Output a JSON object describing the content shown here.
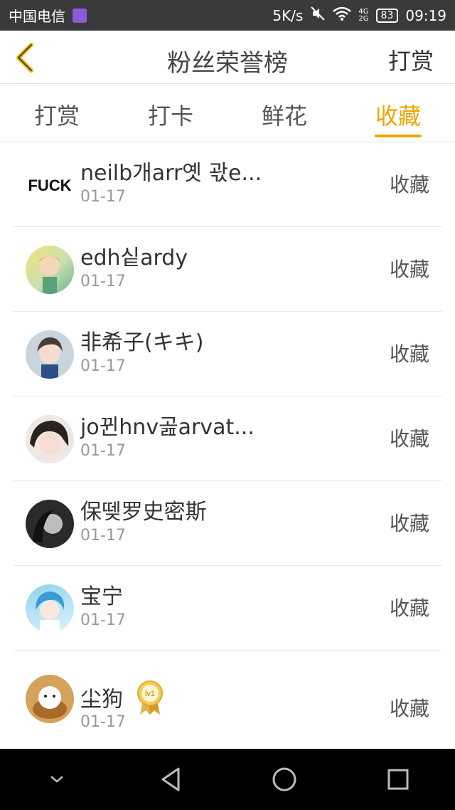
{
  "status_bar": {
    "carrier": "中国电信",
    "speed": "5K/s",
    "battery": "83",
    "time": "09:19",
    "net_4g": "4G",
    "net_2g": "2G"
  },
  "header": {
    "title": "粉丝荣誉榜",
    "right_action": "打赏"
  },
  "tabs": [
    {
      "label": "打赏",
      "active": false
    },
    {
      "label": "打卡",
      "active": false
    },
    {
      "label": "鲜花",
      "active": false
    },
    {
      "label": "收藏",
      "active": true
    }
  ],
  "list": [
    {
      "name": "neilb개arr옛 곿e...",
      "date": "01-17",
      "action": "收藏",
      "avatar_text": "FUCK"
    },
    {
      "name": "edh싵ardy",
      "date": "01-17",
      "action": "收藏"
    },
    {
      "name": "非希子(キキ)",
      "date": "01-17",
      "action": "收藏"
    },
    {
      "name": "jo뀐hnv곮arvat...",
      "date": "01-17",
      "action": "收藏"
    },
    {
      "name": "保뗒罗史密斯",
      "date": "01-17",
      "action": "收藏"
    },
    {
      "name": "宝宁",
      "date": "01-17",
      "action": "收藏"
    },
    {
      "name": "尘狗",
      "date": "01-17",
      "action": "收藏",
      "badge": "lv1"
    }
  ],
  "colors": {
    "accent": "#f2a300",
    "status_bar": "#3a3a3a",
    "nav_bar": "#000000"
  }
}
